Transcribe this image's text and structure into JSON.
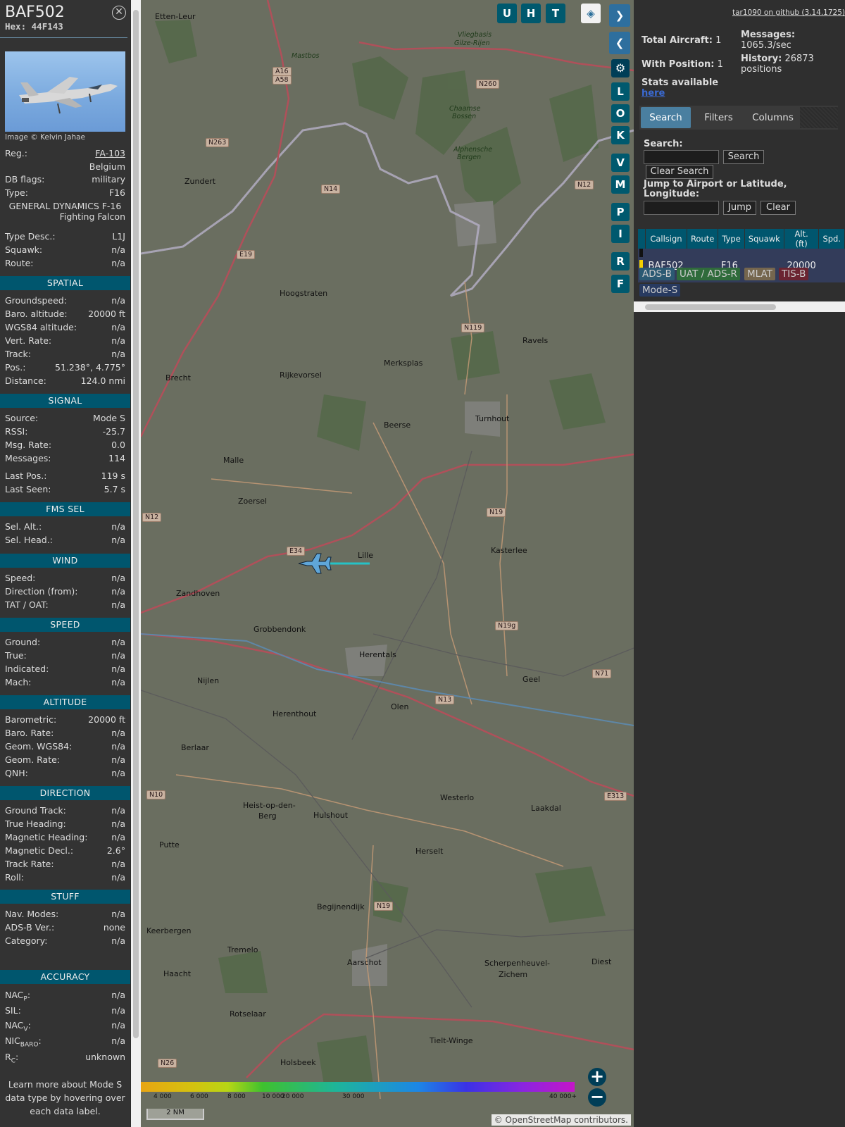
{
  "info": {
    "callsign": "BAF502",
    "hex_label": "Hex:",
    "hex": "44F143",
    "photo_credit": "Image © Kelvin Jahae",
    "reg": {
      "label": "Reg.:",
      "value": "FA-103"
    },
    "country": "Belgium",
    "dbflags": {
      "label": "DB flags:",
      "value": "military"
    },
    "type": {
      "label": "Type:",
      "value": "F16"
    },
    "type_name_1": "GENERAL DYNAMICS F-16",
    "type_name_2": "Fighting Falcon",
    "type_desc": {
      "label": "Type Desc.:",
      "value": "L1J"
    },
    "squawk": {
      "label": "Squawk:",
      "value": "n/a"
    },
    "route": {
      "label": "Route:",
      "value": "n/a"
    },
    "sections": {
      "spatial": "SPATIAL",
      "signal": "SIGNAL",
      "fms": "FMS SEL",
      "wind": "WIND",
      "speed": "SPEED",
      "altitude": "ALTITUDE",
      "direction": "DIRECTION",
      "stuff": "STUFF",
      "accuracy": "ACCURACY"
    },
    "spatial": [
      {
        "label": "Groundspeed:",
        "value": "n/a"
      },
      {
        "label": "Baro. altitude:",
        "value": "20000 ft"
      },
      {
        "label": "WGS84 altitude:",
        "value": "n/a"
      },
      {
        "label": "Vert. Rate:",
        "value": "n/a"
      },
      {
        "label": "Track:",
        "value": "n/a"
      },
      {
        "label": "Pos.:",
        "value": "51.238°, 4.775°"
      },
      {
        "label": "Distance:",
        "value": "124.0 nmi"
      }
    ],
    "signal": [
      {
        "label": "Source:",
        "value": "Mode S"
      },
      {
        "label": "RSSI:",
        "value": "-25.7"
      },
      {
        "label": "Msg. Rate:",
        "value": "0.0"
      },
      {
        "label": "Messages:",
        "value": "114"
      },
      {
        "label": "Last Pos.:",
        "value": "119 s"
      },
      {
        "label": "Last Seen:",
        "value": "5.7 s"
      }
    ],
    "fms": [
      {
        "label": "Sel. Alt.:",
        "value": "n/a"
      },
      {
        "label": "Sel. Head.:",
        "value": "n/a"
      }
    ],
    "wind": [
      {
        "label": "Speed:",
        "value": "n/a"
      },
      {
        "label": "Direction (from):",
        "value": "n/a"
      },
      {
        "label": "TAT / OAT:",
        "value": "n/a"
      }
    ],
    "speed": [
      {
        "label": "Ground:",
        "value": "n/a"
      },
      {
        "label": "True:",
        "value": "n/a"
      },
      {
        "label": "Indicated:",
        "value": "n/a"
      },
      {
        "label": "Mach:",
        "value": "n/a"
      }
    ],
    "altitude": [
      {
        "label": "Barometric:",
        "value": "20000 ft"
      },
      {
        "label": "Baro. Rate:",
        "value": "n/a"
      },
      {
        "label": "Geom. WGS84:",
        "value": "n/a"
      },
      {
        "label": "Geom. Rate:",
        "value": "n/a"
      },
      {
        "label": "QNH:",
        "value": "n/a"
      }
    ],
    "direction": [
      {
        "label": "Ground Track:",
        "value": "n/a"
      },
      {
        "label": "True Heading:",
        "value": "n/a"
      },
      {
        "label": "Magnetic Heading:",
        "value": "n/a"
      },
      {
        "label": "Magnetic Decl.:",
        "value": "2.6°"
      },
      {
        "label": "Track Rate:",
        "value": "n/a"
      },
      {
        "label": "Roll:",
        "value": "n/a"
      }
    ],
    "stuff": [
      {
        "label": "Nav. Modes:",
        "value": "n/a"
      },
      {
        "label": "ADS-B Ver.:",
        "value": "none"
      },
      {
        "label": "Category:",
        "value": "n/a"
      }
    ],
    "accuracy": [
      {
        "label": "NAC",
        "sub": "P",
        "value": "n/a"
      },
      {
        "label": "SIL:",
        "sub": "",
        "value": "n/a"
      },
      {
        "label": "NAC",
        "sub": "V",
        "value": "n/a"
      },
      {
        "label": "NIC",
        "sub": "BARO",
        "value": "n/a"
      },
      {
        "label": "R",
        "sub": "C",
        "value": "unknown"
      }
    ],
    "footer": "Learn more about Mode S data type by hovering over each data label."
  },
  "map": {
    "buttons": [
      "U",
      "H",
      "T"
    ],
    "side_buttons": [
      "L",
      "O",
      "K",
      "V",
      "M",
      "P",
      "I",
      "R",
      "F"
    ],
    "towns": [
      {
        "n": "Etten-Leur"
      },
      {
        "n": "Zundert"
      },
      {
        "n": "Hoogstraten"
      },
      {
        "n": "Brecht"
      },
      {
        "n": "Rijkevorsel"
      },
      {
        "n": "Merksplas"
      },
      {
        "n": "Ravels"
      },
      {
        "n": "Beerse"
      },
      {
        "n": "Turnhout"
      },
      {
        "n": "Malle"
      },
      {
        "n": "Zoersel"
      },
      {
        "n": "Lille"
      },
      {
        "n": "Kasterlee"
      },
      {
        "n": "Zandhoven"
      },
      {
        "n": "Grobbendonk"
      },
      {
        "n": "Herentals"
      },
      {
        "n": "Nijlen"
      },
      {
        "n": "Geel"
      },
      {
        "n": "Olen"
      },
      {
        "n": "Herenthout"
      },
      {
        "n": "Berlaar"
      },
      {
        "n": "Westerlo"
      },
      {
        "n": "Laakdal"
      },
      {
        "n": "Heist-op-den-"
      },
      {
        "n": "Berg"
      },
      {
        "n": "Hulshout"
      },
      {
        "n": "Putte"
      },
      {
        "n": "Herselt"
      },
      {
        "n": "Begijnendijk"
      },
      {
        "n": "Keerbergen"
      },
      {
        "n": "Tremelo"
      },
      {
        "n": "Aarschot"
      },
      {
        "n": "Scherpenheuvel-"
      },
      {
        "n": "Zichem"
      },
      {
        "n": "Diest"
      },
      {
        "n": "Haacht"
      },
      {
        "n": "Rotselaar"
      },
      {
        "n": "Tielt-Winge"
      },
      {
        "n": "Holsbeek"
      },
      {
        "n": "Mastbos"
      },
      {
        "n": "Chaamse"
      },
      {
        "n": "Bossen"
      },
      {
        "n": "Alphensche"
      },
      {
        "n": "Bergen"
      },
      {
        "n": "Vliegbasis"
      },
      {
        "n": "Gilze-Rijen"
      }
    ],
    "roads": [
      {
        "n": "A16"
      },
      {
        "n": "A58"
      },
      {
        "n": "N263"
      },
      {
        "n": "N260"
      },
      {
        "n": "N14"
      },
      {
        "n": "N12"
      },
      {
        "n": "E19"
      },
      {
        "n": "N119"
      },
      {
        "n": "N12"
      },
      {
        "n": "E34"
      },
      {
        "n": "N19"
      },
      {
        "n": "N19g"
      },
      {
        "n": "N13"
      },
      {
        "n": "N71"
      },
      {
        "n": "N10"
      },
      {
        "n": "E313"
      },
      {
        "n": "N19"
      },
      {
        "n": "N26"
      }
    ],
    "alt_labels": [
      "4 000",
      "6 000",
      "8 000",
      "10 000",
      "20 000",
      "30 000",
      "40 000+"
    ],
    "scale": "2 NM",
    "attribution": "© OpenStreetMap contributors."
  },
  "right": {
    "github": "tar1090 on github (3.14.1725)",
    "total_aircraft_label": "Total Aircraft:",
    "total_aircraft": "1",
    "with_position_label": "With Position:",
    "with_position": "1",
    "messages_label": "Messages:",
    "messages_rate": "1065.3/sec",
    "history_label": "History:",
    "history_value": "26873",
    "history_unit": "positions",
    "stats_label": "Stats available",
    "stats_link": "here",
    "tabs": [
      "Search",
      "Filters",
      "Columns"
    ],
    "search_label": "Search:",
    "search_button": "Search",
    "clear_search_button": "Clear Search",
    "jump_label": "Jump to Airport or Latitude, Longitude:",
    "jump_button": "Jump",
    "clear_button": "Clear",
    "table": {
      "headers": [
        "",
        "Callsign",
        "Route",
        "Type",
        "Squawk",
        "Alt. (ft)",
        "Spd."
      ],
      "row": {
        "callsign": "BAF502",
        "route": "",
        "type": "F16",
        "squawk": "",
        "alt": "20000",
        "spd": ""
      }
    },
    "sources": [
      "ADS-B",
      "UAT / ADS-R",
      "MLAT",
      "TIS-B",
      "Mode-S"
    ]
  }
}
